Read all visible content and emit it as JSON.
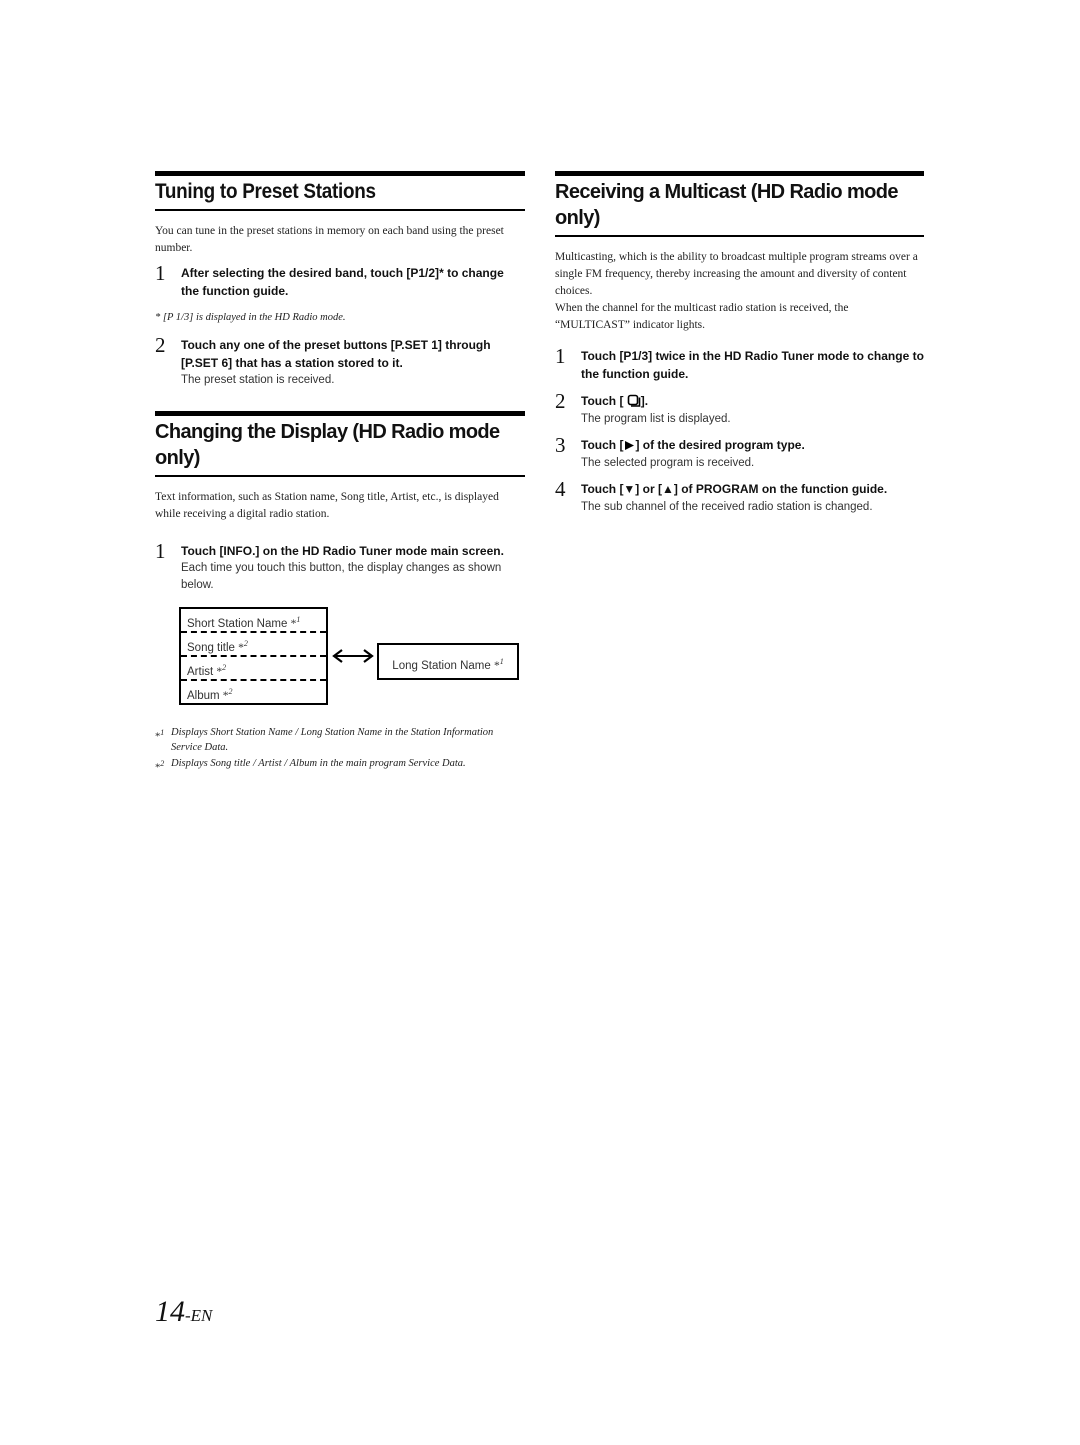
{
  "left_column": {
    "section1": {
      "title": "Tuning to Preset Stations",
      "intro": "You can tune in the preset stations in memory on each band using the preset number.",
      "steps": [
        {
          "number": "1",
          "title_pre": "After selecting the desired band, touch ",
          "button": "[P1/2]",
          "title_post": "* to change the function guide.",
          "desc": ""
        },
        {
          "number": "2",
          "title_pre": "Touch any one of the preset buttons ",
          "button": "[P.SET 1]",
          "title_mid": " through ",
          "button2": "[P.SET 6]",
          "title_post": " that has a station stored to it.",
          "desc": "The preset station is received."
        }
      ],
      "note": "*  [P 1/3] is displayed in the HD Radio mode."
    },
    "section2": {
      "title": "Changing the Display (HD Radio mode only)",
      "intro": "Text information, such as Station name, Song title, Artist, etc., is displayed while receiving a digital radio station.",
      "steps": [
        {
          "number": "1",
          "title_pre": "Touch ",
          "button": "[INFO.]",
          "title_post": " on the HD Radio Tuner mode main screen.",
          "desc": "Each time you touch this button, the display changes as shown below."
        }
      ],
      "diagram": {
        "left_items": [
          {
            "label": "Short Station Name ",
            "mark": "*",
            "sup": "1"
          },
          {
            "label": "Song title ",
            "mark": "*",
            "sup": "2"
          },
          {
            "label": "Artist ",
            "mark": "*",
            "sup": "2"
          },
          {
            "label": "Album ",
            "mark": "*",
            "sup": "2"
          }
        ],
        "right_item": {
          "label": "Long Station Name ",
          "mark": "*",
          "sup": "1"
        },
        "arrow_icon": "double-arrow-icon"
      },
      "footnotes": [
        {
          "mark": "*",
          "sup": "1",
          "text": "Displays Short Station Name / Long Station Name in the Station Information Service Data."
        },
        {
          "mark": "*",
          "sup": "2",
          "text": "Displays Song title / Artist / Album in the main program Service Data."
        }
      ]
    }
  },
  "right_column": {
    "section3": {
      "title": "Receiving a Multicast (HD Radio mode only)",
      "intro1": "Multicasting, which is the ability to broadcast multiple program streams over a single FM frequency, thereby increasing the amount and diversity of content choices.",
      "intro2": "When the channel for the multicast radio station is received, the “MULTICAST” indicator lights.",
      "steps": [
        {
          "number": "1",
          "title_pre": "Touch ",
          "button": "[P1/3]",
          "title_post": " twice in the HD Radio Tuner mode to change to the function guide.",
          "desc": ""
        },
        {
          "number": "2",
          "title_pre": "Touch ",
          "button_open": "[",
          "icon": "program-list-icon",
          "button_close": "]",
          "title_post": ".",
          "desc": "The program list is displayed."
        },
        {
          "number": "3",
          "title_pre": "Touch ",
          "button_open": "[",
          "icon": "play-icon",
          "button_close": "]",
          "title_post": " of the desired program type.",
          "desc": "The selected program is received."
        },
        {
          "number": "4",
          "title_pre": "Touch ",
          "button_down": "[▼]",
          "title_mid": " or ",
          "button_up": "[▲]",
          "title_post": " of PROGRAM on the function guide.",
          "desc": "The sub channel of the received radio station is changed."
        }
      ]
    }
  },
  "footer": {
    "page_number": "14",
    "page_suffix": "-EN"
  }
}
